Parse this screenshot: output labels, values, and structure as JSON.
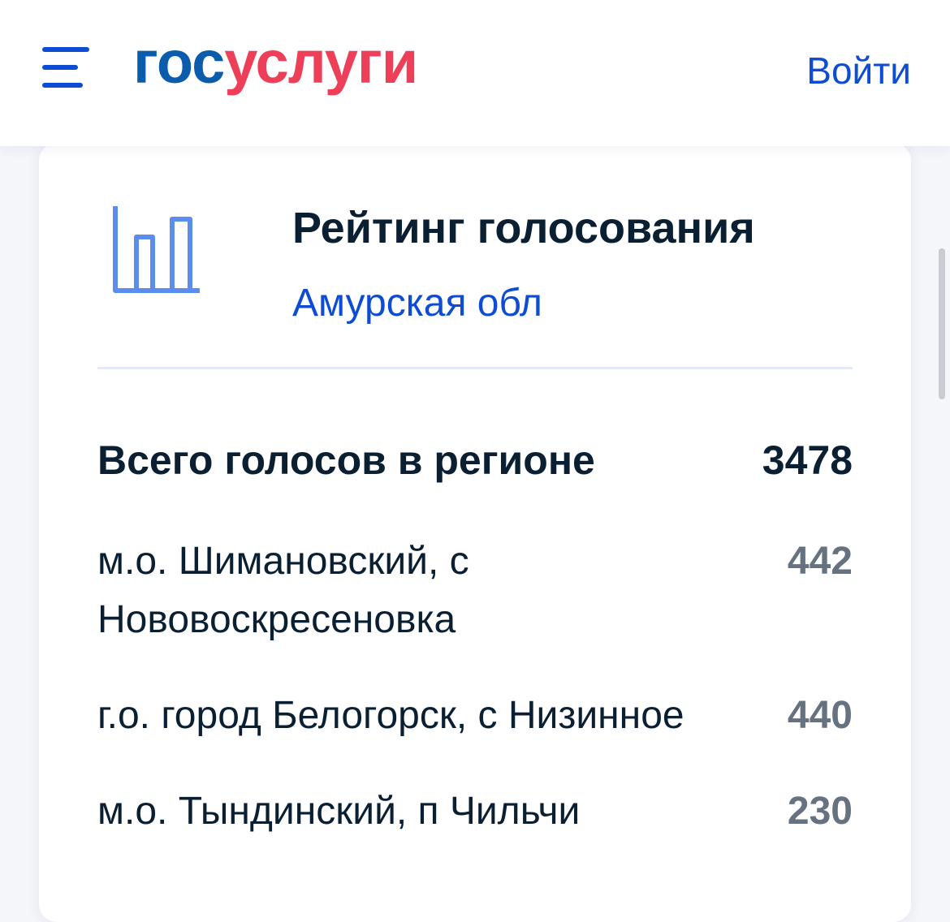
{
  "header": {
    "logo": {
      "part1": "гос",
      "part2": "услуги"
    },
    "login_label": "Войти"
  },
  "card": {
    "title": "Рейтинг голосования",
    "subtitle": "Амурская обл",
    "total_label": "Всего голосов в регионе",
    "total_value": "3478",
    "rows": [
      {
        "label": "м.о. Шимановский, с Нововоскресеновка",
        "value": "442"
      },
      {
        "label": "г.о. город Белогорск, с Низинное",
        "value": "440"
      },
      {
        "label": "м.о. Тындинский, п Чильчи",
        "value": "230"
      }
    ]
  },
  "icons": {
    "menu": "hamburger-menu-icon",
    "chart": "bar-chart-icon"
  },
  "colors": {
    "primary_blue": "#0d4cd3",
    "logo_blue": "#0b5cad",
    "logo_red": "#ee3f58",
    "chart_icon": "#5b8def",
    "text_dark": "#0b1f33",
    "text_gray": "#66727f"
  }
}
